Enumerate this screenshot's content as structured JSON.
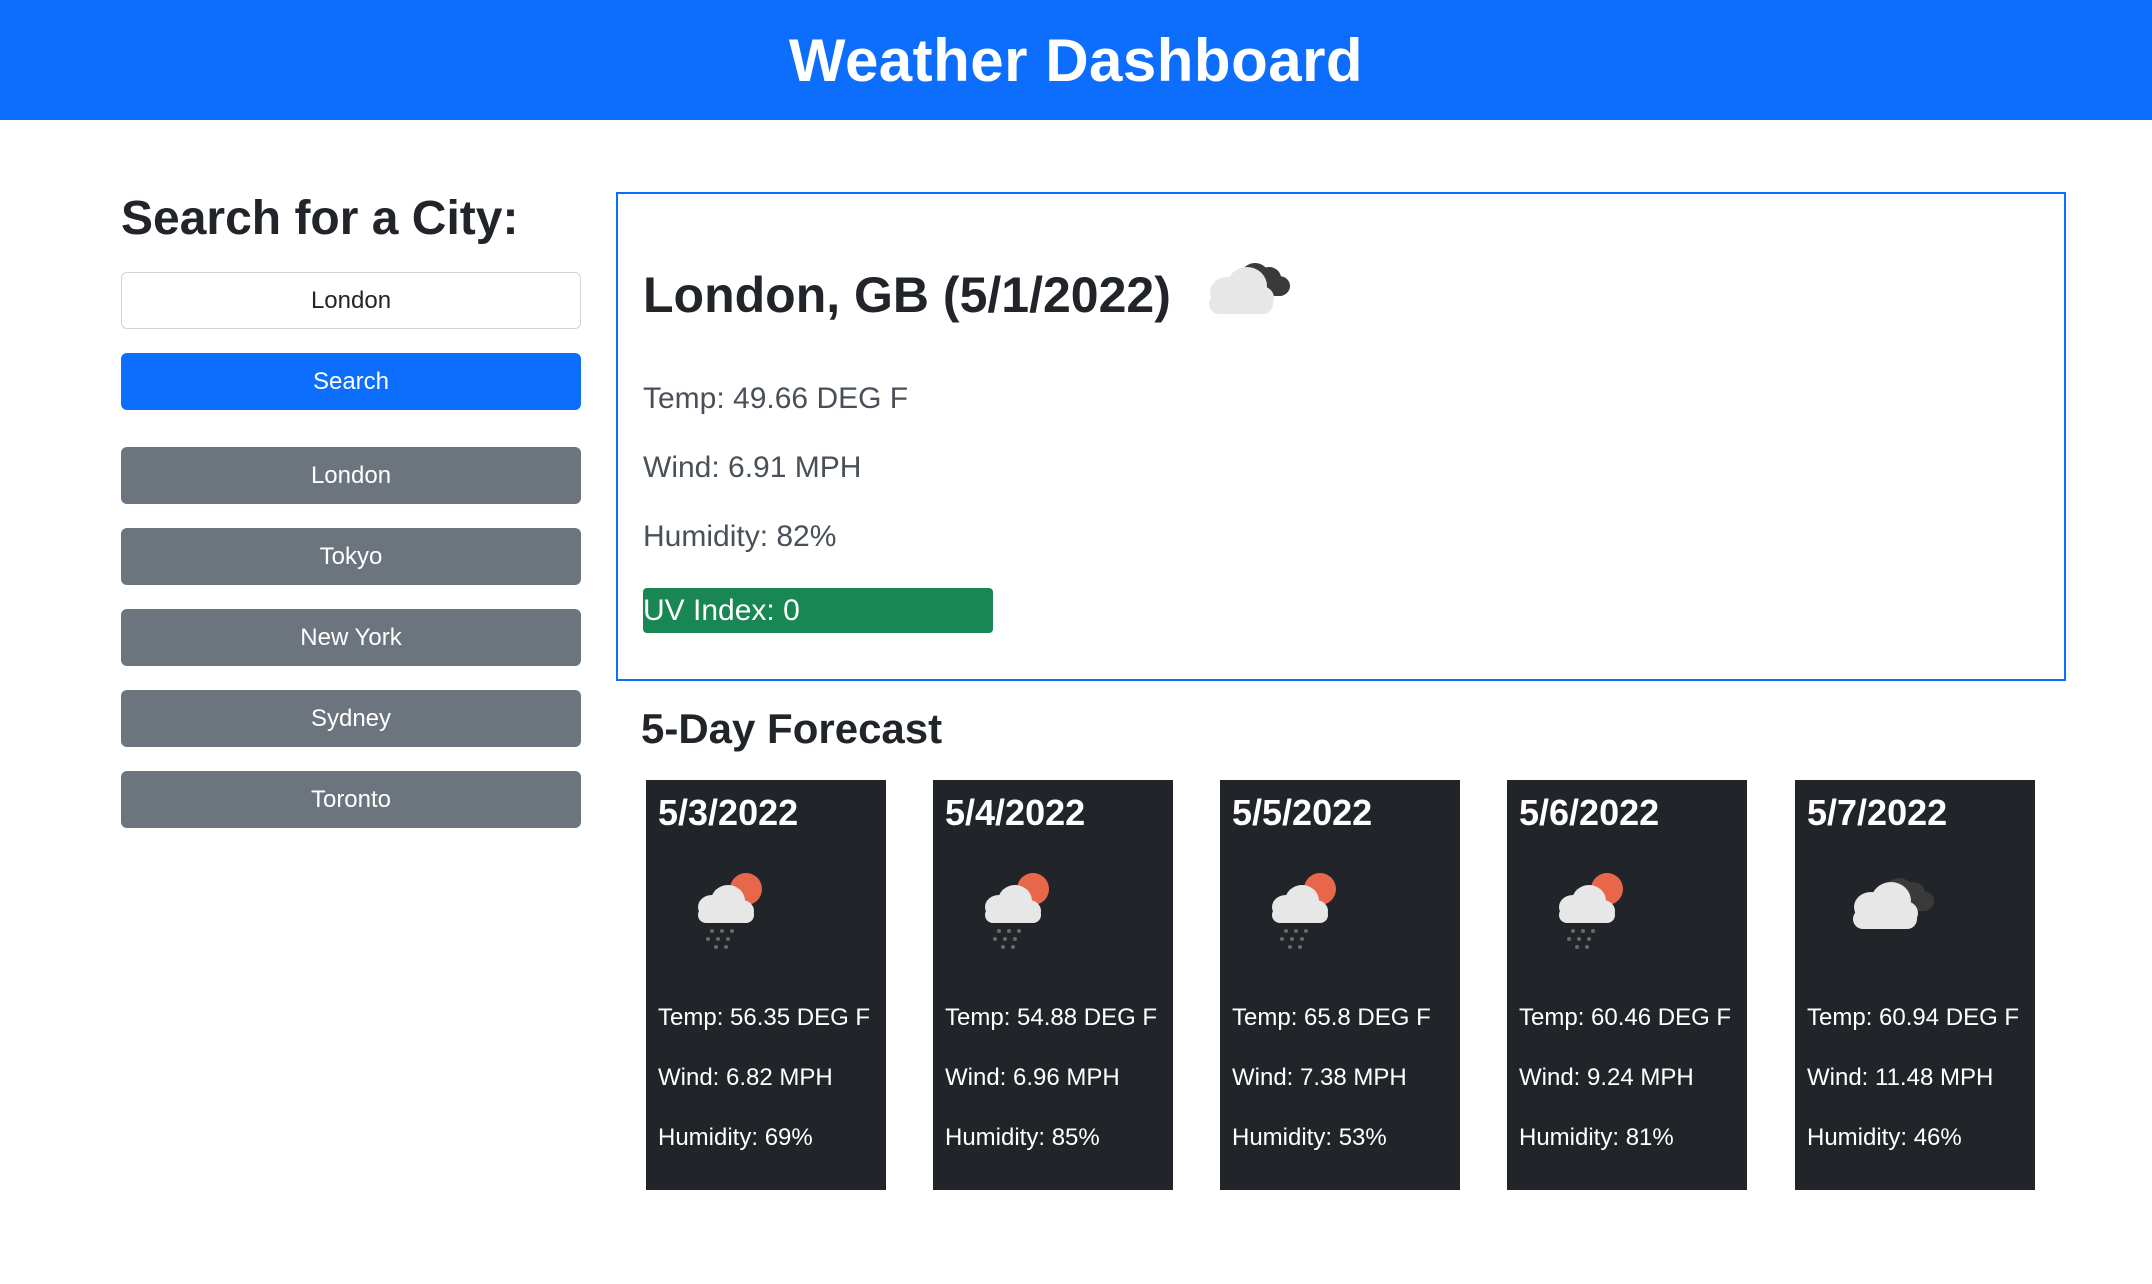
{
  "header": {
    "title": "Weather Dashboard"
  },
  "search": {
    "heading": "Search for a City:",
    "input_value": "London",
    "button_label": "Search"
  },
  "history": [
    "London",
    "Tokyo",
    "New York",
    "Sydney",
    "Toronto"
  ],
  "current": {
    "title": "London, GB (5/1/2022)",
    "icon": "broken-clouds-icon",
    "temp": "Temp: 49.66 DEG F",
    "wind": "Wind: 6.91 MPH",
    "humidity": "Humidity: 82%",
    "uv": "UV Index: 0",
    "uv_color": "#198754"
  },
  "forecast": {
    "heading": "5-Day Forecast",
    "days": [
      {
        "date": "5/3/2022",
        "icon": "rain-sun-icon",
        "temp": "Temp: 56.35 DEG F",
        "wind": "Wind: 6.82 MPH",
        "humidity": "Humidity: 69%"
      },
      {
        "date": "5/4/2022",
        "icon": "rain-sun-icon",
        "temp": "Temp: 54.88 DEG F",
        "wind": "Wind: 6.96 MPH",
        "humidity": "Humidity: 85%"
      },
      {
        "date": "5/5/2022",
        "icon": "rain-sun-icon",
        "temp": "Temp: 65.8 DEG F",
        "wind": "Wind: 7.38 MPH",
        "humidity": "Humidity: 53%"
      },
      {
        "date": "5/6/2022",
        "icon": "rain-sun-icon",
        "temp": "Temp: 60.46 DEG F",
        "wind": "Wind: 9.24 MPH",
        "humidity": "Humidity: 81%"
      },
      {
        "date": "5/7/2022",
        "icon": "broken-clouds-icon",
        "temp": "Temp: 60.94 DEG F",
        "wind": "Wind: 11.48 MPH",
        "humidity": "Humidity: 46%"
      }
    ]
  },
  "colors": {
    "primary": "#0d6efd",
    "secondary": "#6c757d",
    "dark": "#212529",
    "success": "#198754"
  }
}
